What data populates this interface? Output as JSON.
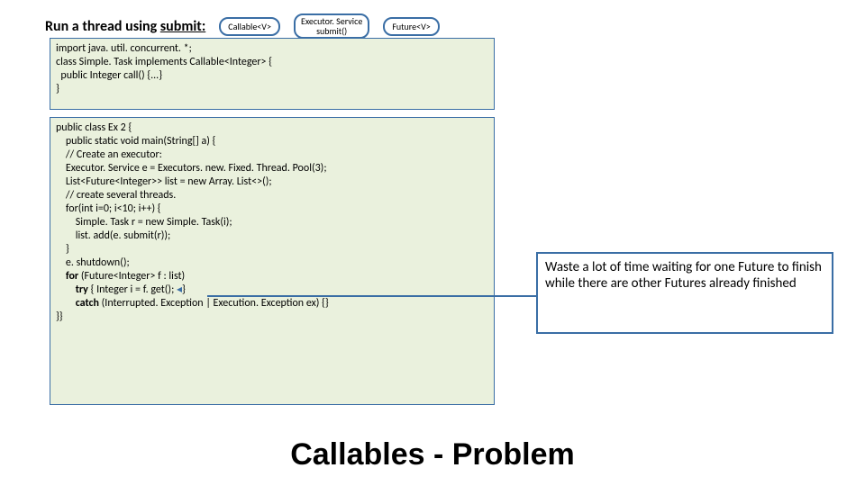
{
  "heading": {
    "prefix": "Run a thread using ",
    "underlined": "submit:"
  },
  "pills": {
    "callable": "Callable<V>",
    "executor_l1": "Executor. Service",
    "executor_l2": "submit()",
    "future": "Future<V>"
  },
  "code1": {
    "l1": "import java. util. concurrent. *;",
    "l2": "class Simple. Task implements Callable<Integer> {",
    "l3": "  public Integer call() {...}",
    "l4": "}"
  },
  "code2": {
    "l1": "public class Ex 2 {",
    "l2": "    public static void main(String[] a) {",
    "l3": "    // Create an executor:",
    "l4": "    Executor. Service e = Executors. new. Fixed. Thread. Pool(3);",
    "l5": "    List<Future<Integer>> list = new Array. List<>();",
    "l6": "    // create several threads.",
    "l7": "    for(int i=0; i<10; i++) {",
    "l8": "        Simple. Task r = new Simple. Task(i);",
    "l9": "        list. add(e. submit(r));",
    "l10": "    }",
    "l11": "    e. shutdown();",
    "l12a": "    ",
    "l12b": "for ",
    "l12c": "(Future<Integer> f : list)",
    "l13a": "        ",
    "l13b": "try ",
    "l13c": "{ Integer i = f. get(); ",
    "l13d": "}",
    "l14a": "        ",
    "l14b": "catch ",
    "l14c": "(Interrupted. Exception | Execution. Exception ex) {}",
    "l15": "}}"
  },
  "callout": "Waste a lot of time waiting for one Future to finish while there are other Futures already finished",
  "footer": "Callables - Problem"
}
